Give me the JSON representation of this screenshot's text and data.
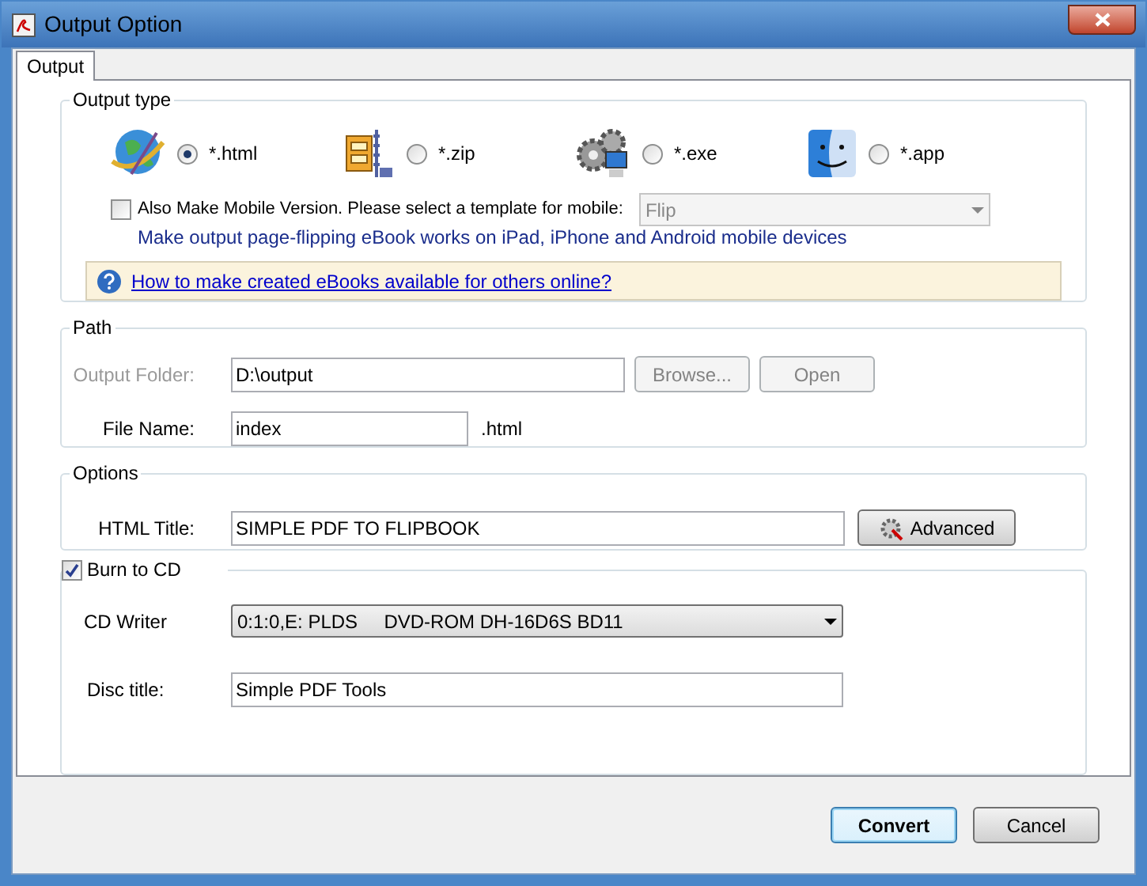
{
  "window": {
    "title": "Output Option"
  },
  "tabs": [
    {
      "label": "Output",
      "selected": true
    }
  ],
  "output_type": {
    "title": "Output type",
    "options": [
      {
        "kind": "globe",
        "label": "*.html",
        "selected": true
      },
      {
        "kind": "zip",
        "label": "*.zip",
        "selected": false
      },
      {
        "kind": "gears",
        "label": "*.exe",
        "selected": false
      },
      {
        "kind": "mac",
        "label": "*.app",
        "selected": false
      }
    ],
    "mobile": {
      "label": "Also Make Mobile Version. Please select a template for mobile:",
      "checked": false,
      "template": "Flip",
      "template_disabled": true,
      "note": "Make output page-flipping eBook works on iPad, iPhone and Android mobile devices"
    },
    "help_link": "How to make created eBooks available for others online?"
  },
  "path": {
    "title": "Path",
    "output_folder": {
      "label": "Output Folder:",
      "value": "D:\\output",
      "disabled": true
    },
    "buttons": [
      {
        "label": "Browse...",
        "disabled": true
      },
      {
        "label": "Open",
        "disabled": true
      }
    ],
    "file_name": {
      "label": "File Name:",
      "value": "index",
      "suffix": ".html"
    }
  },
  "options": {
    "title": "Options",
    "html_title": {
      "label": "HTML Title:",
      "value": "SIMPLE PDF TO FLIPBOOK"
    },
    "advanced_button": "Advanced"
  },
  "burn": {
    "label": "Burn to CD",
    "checked": true,
    "cd_writer": {
      "label": "CD Writer",
      "value": "0:1:0,E: PLDS     DVD-ROM DH-16D6S BD11"
    },
    "disc_title": {
      "label": "Disc title:",
      "value": "Simple PDF Tools"
    }
  },
  "buttons": [
    {
      "label": "Convert",
      "default": true
    },
    {
      "label": "Cancel",
      "default": false
    }
  ]
}
